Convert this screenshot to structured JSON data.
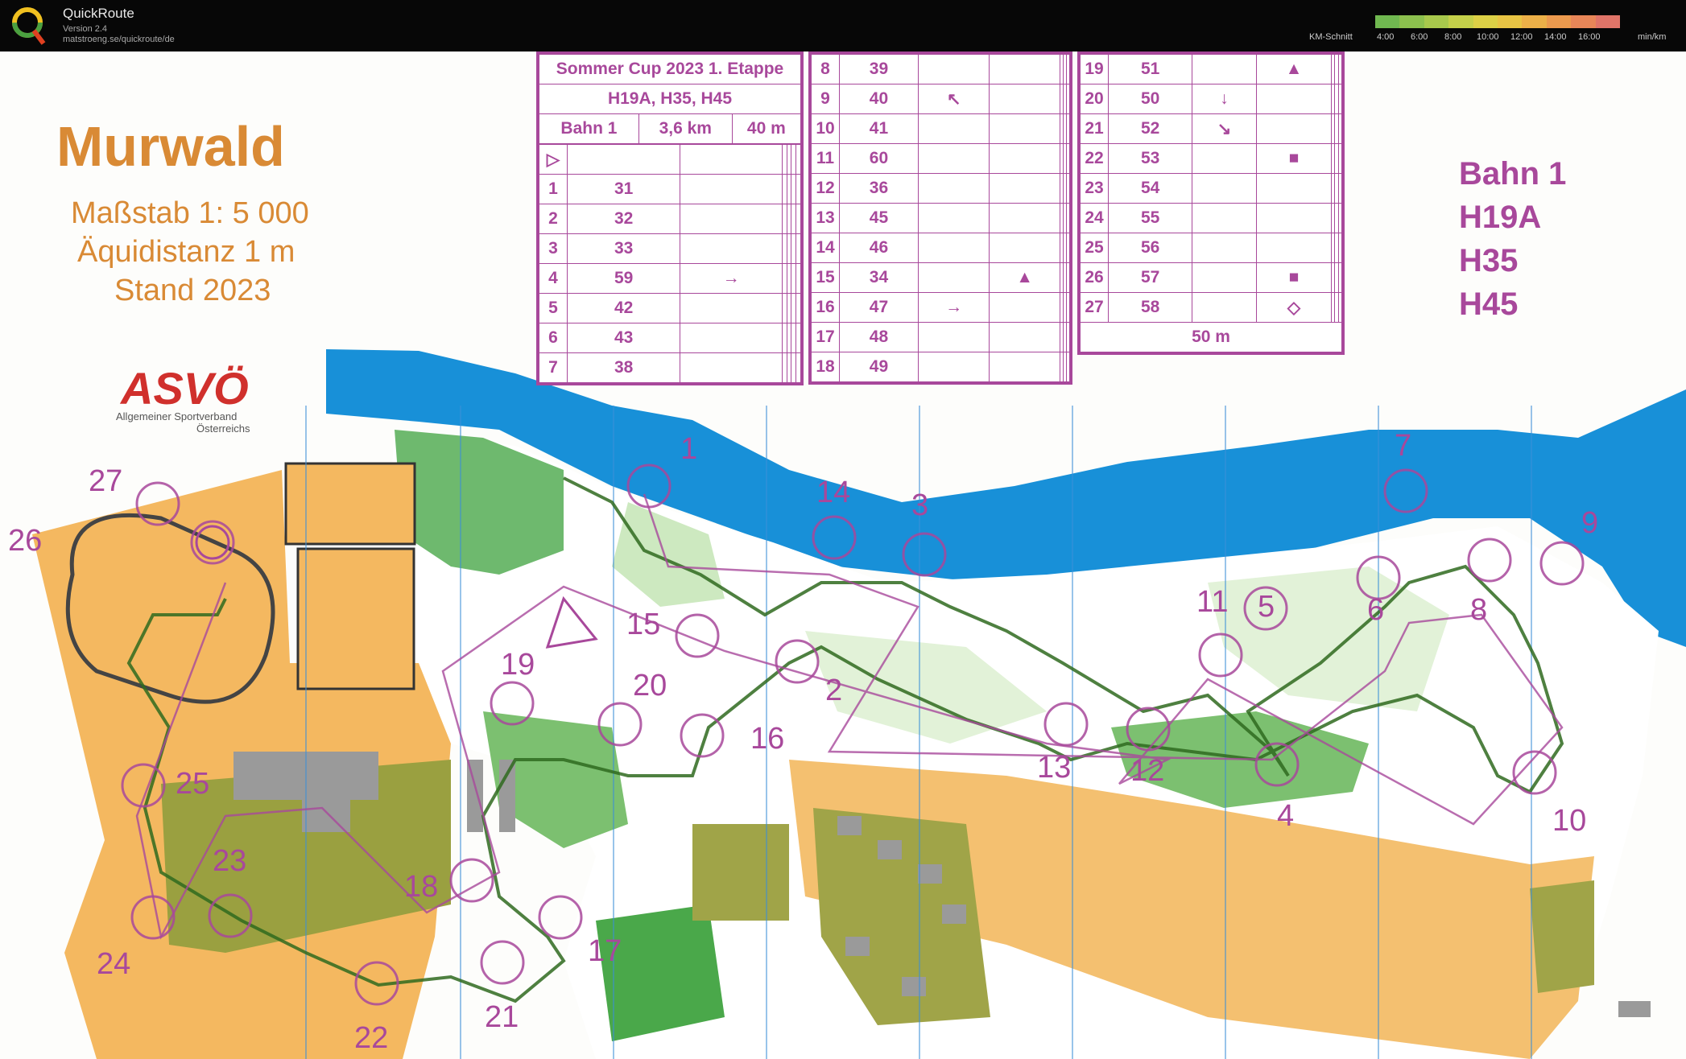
{
  "app": {
    "title": "QuickRoute",
    "version": "Version 2.4",
    "url": "matstroeng.se/quickroute/de",
    "km_label": "KM-Schnitt",
    "unit": "min/km",
    "legend_ticks": [
      "4:00",
      "6:00",
      "8:00",
      "10:00",
      "12:00",
      "14:00",
      "16:00"
    ],
    "legend_colors": [
      "#70b850",
      "#8cc04e",
      "#a8c84c",
      "#c4d04a",
      "#dcd046",
      "#e8c444",
      "#ecb048",
      "#ec9a4e",
      "#e88658",
      "#e07468"
    ]
  },
  "map": {
    "title": "Murwald",
    "scale": "Maßstab 1: 5 000",
    "equidistance": "Äquidistanz 1 m",
    "status": "Stand 2023",
    "sponsor_logo": "ASVÖ",
    "sponsor_line1": "Allgemeiner Sportverband",
    "sponsor_line2": "Österreichs",
    "course": {
      "name": "Bahn 1",
      "classes": [
        "H19A",
        "H35",
        "H45"
      ]
    },
    "description": {
      "event": "Sommer Cup 2023 1. Etappe",
      "classes": "H19A, H35, H45",
      "course": "Bahn 1",
      "length": "3,6 km",
      "climb": "40 m",
      "finish_distance": "50 m",
      "col1": [
        {
          "n": "1",
          "code": "31"
        },
        {
          "n": "2",
          "code": "32"
        },
        {
          "n": "3",
          "code": "33"
        },
        {
          "n": "4",
          "code": "59"
        },
        {
          "n": "5",
          "code": "42"
        },
        {
          "n": "6",
          "code": "43"
        },
        {
          "n": "7",
          "code": "38"
        }
      ],
      "col2": [
        {
          "n": "8",
          "code": "39"
        },
        {
          "n": "9",
          "code": "40"
        },
        {
          "n": "10",
          "code": "41"
        },
        {
          "n": "11",
          "code": "60"
        },
        {
          "n": "12",
          "code": "36"
        },
        {
          "n": "13",
          "code": "45"
        },
        {
          "n": "14",
          "code": "46"
        },
        {
          "n": "15",
          "code": "34"
        },
        {
          "n": "16",
          "code": "47"
        },
        {
          "n": "17",
          "code": "48"
        },
        {
          "n": "18",
          "code": "49"
        }
      ],
      "col3": [
        {
          "n": "19",
          "code": "51"
        },
        {
          "n": "20",
          "code": "50"
        },
        {
          "n": "21",
          "code": "52"
        },
        {
          "n": "22",
          "code": "53"
        },
        {
          "n": "23",
          "code": "54"
        },
        {
          "n": "24",
          "code": "55"
        },
        {
          "n": "25",
          "code": "56"
        },
        {
          "n": "26",
          "code": "57"
        },
        {
          "n": "27",
          "code": "58"
        }
      ]
    },
    "controls": [
      "1",
      "2",
      "3",
      "4",
      "5",
      "6",
      "7",
      "8",
      "9",
      "10",
      "11",
      "12",
      "13",
      "14",
      "15",
      "16",
      "17",
      "18",
      "19",
      "20",
      "21",
      "22",
      "23",
      "24",
      "25",
      "26",
      "27"
    ]
  }
}
